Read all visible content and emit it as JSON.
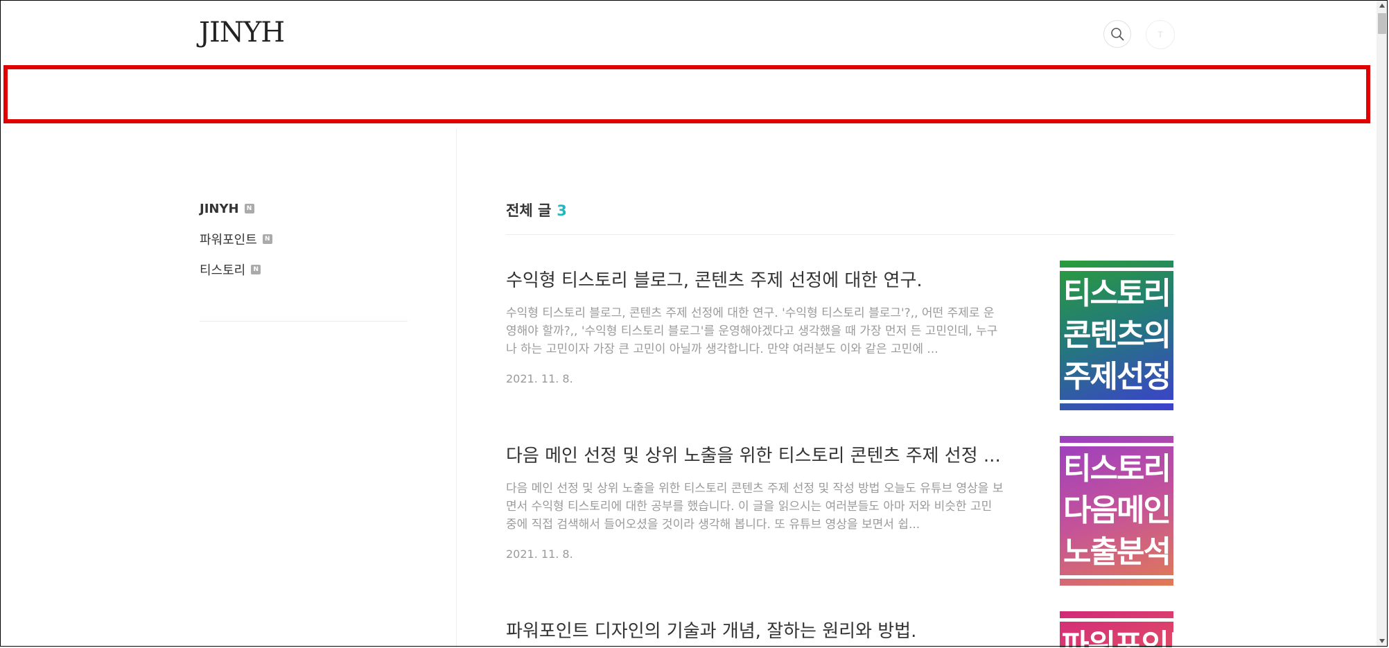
{
  "header": {
    "logo": "JINYH",
    "search_icon": "search-icon",
    "avatar_initial": "T"
  },
  "sidebar": {
    "items": [
      {
        "label": "JINYH",
        "badge": "N",
        "bold": true
      },
      {
        "label": "파워포인트",
        "badge": "N",
        "bold": false
      },
      {
        "label": "티스토리",
        "badge": "N",
        "bold": false
      }
    ]
  },
  "main": {
    "section_label": "전체 글",
    "section_count": "3",
    "accent_color": "#1fb8c1",
    "posts": [
      {
        "title": "수익형 티스토리 블로그, 콘텐츠 주제 선정에 대한 연구.",
        "excerpt": "수익형 티스토리 블로그, 콘텐츠 주제 선정에 대한 연구. '수익형 티스토리 블로그'?,, 어떤 주제로 운영해야 할까?,, '수익형 티스토리 블로그'를 운영해야겠다고 생각했을 때 가장 먼저 든 고민인데, 누구나 하는 고민이자 가장 큰 고민이 아닐까 생각합니다. 만약 여러분도 이와 같은 고민에 ...",
        "date": "2021. 11. 8.",
        "thumb_lines": [
          "티스토리",
          "콘텐츠의",
          "주제선정"
        ]
      },
      {
        "title": "다음 메인 선정 및 상위 노출을 위한 티스토리 콘텐츠 주제 선정 ...",
        "excerpt": "다음 메인 선정 및 상위 노출을 위한 티스토리 콘텐츠 주제 선정 및 작성 방법 오늘도 유튜브 영상을 보면서 수익형 티스토리에 대한 공부를 했습니다. 이 글을 읽으시는 여러분들도 아마 저와 비슷한 고민 중에 직접 검색해서 들어오셨을 것이라 생각해 봅니다. 또 유튜브 영상을 보면서 쉽...",
        "date": "2021. 11. 8.",
        "thumb_lines": [
          "티스토리",
          "다음메인",
          "노출분석"
        ]
      },
      {
        "title": "파워포인트 디자인의 기술과 개념, 잘하는 원리와 방법.",
        "thumb_lines": [
          "파워포인트"
        ]
      }
    ]
  }
}
